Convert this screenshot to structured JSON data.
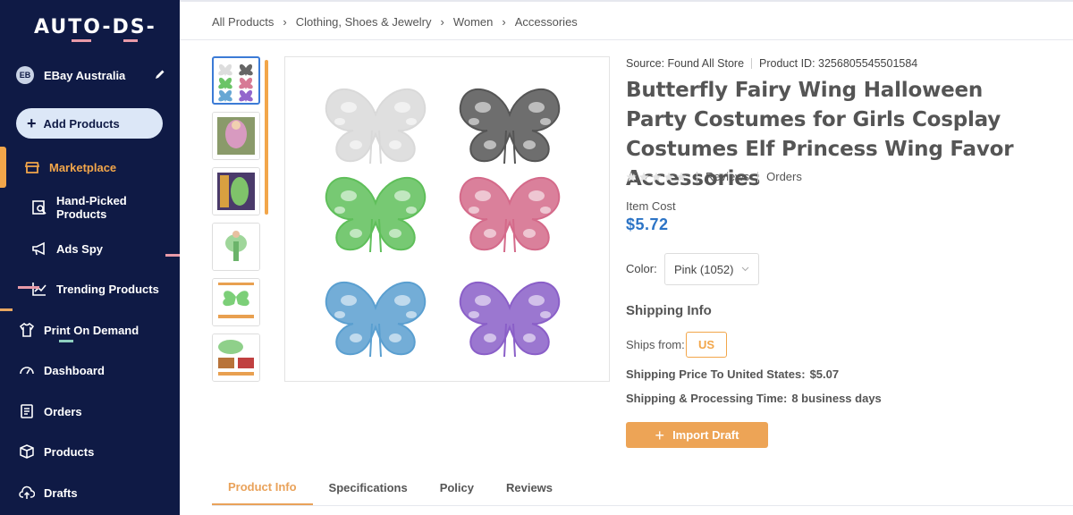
{
  "sidebar": {
    "logo_text": "AUTO-DS-",
    "store": {
      "initials": "EB",
      "name": "EBay Australia"
    },
    "add_products_label": "Add Products",
    "items": [
      {
        "label": "Marketplace",
        "icon": "store-icon",
        "active": true
      },
      {
        "label": "Hand-Picked Products",
        "icon": "search-list-icon"
      },
      {
        "label": "Ads Spy",
        "icon": "megaphone-icon"
      },
      {
        "label": "Trending Products",
        "icon": "trending-chart-icon"
      },
      {
        "label": "Print On Demand",
        "icon": "tshirt-icon"
      },
      {
        "label": "Dashboard",
        "icon": "gauge-icon"
      },
      {
        "label": "Orders",
        "icon": "document-icon"
      },
      {
        "label": "Products",
        "icon": "box-icon"
      },
      {
        "label": "Drafts",
        "icon": "cloud-upload-icon"
      }
    ]
  },
  "breadcrumb": [
    "All Products",
    "Clothing, Shoes & Jewelry",
    "Women",
    "Accessories"
  ],
  "product": {
    "source_label": "Source: Found All Store",
    "product_id_label": "Product ID: 3256805545501584",
    "title": "Butterfly Fairy Wing Halloween Party Costumes for Girls Cosplay Costumes Elf Princess Wing Favor Accessories",
    "reviews_label": "Reviews",
    "orders_label": "Orders",
    "rating_stars": 0,
    "item_cost_label": "Item Cost",
    "item_cost": "$5.72",
    "color_label": "Color:",
    "color_value": "Pink (1052)",
    "shipping_heading": "Shipping Info",
    "ships_from_label": "Ships from:",
    "ships_from_value": "US",
    "shipping_price_label": "Shipping Price To United States:",
    "shipping_price_value": "$5.07",
    "shipping_time_label": "Shipping & Processing Time:",
    "shipping_time_value": "8 business days",
    "import_label": "Import Draft",
    "wing_colors": [
      "#d9d9d9",
      "#555555",
      "#5fbf5a",
      "#d46a8a",
      "#5a9fd0",
      "#8a5fc8"
    ]
  },
  "tabs": [
    {
      "label": "Product Info",
      "active": true
    },
    {
      "label": "Specifications"
    },
    {
      "label": "Policy"
    },
    {
      "label": "Reviews"
    }
  ],
  "colors": {
    "sidebar_bg": "#0f1a45",
    "accent_orange": "#f2a64a",
    "price_blue": "#2c74c6"
  }
}
